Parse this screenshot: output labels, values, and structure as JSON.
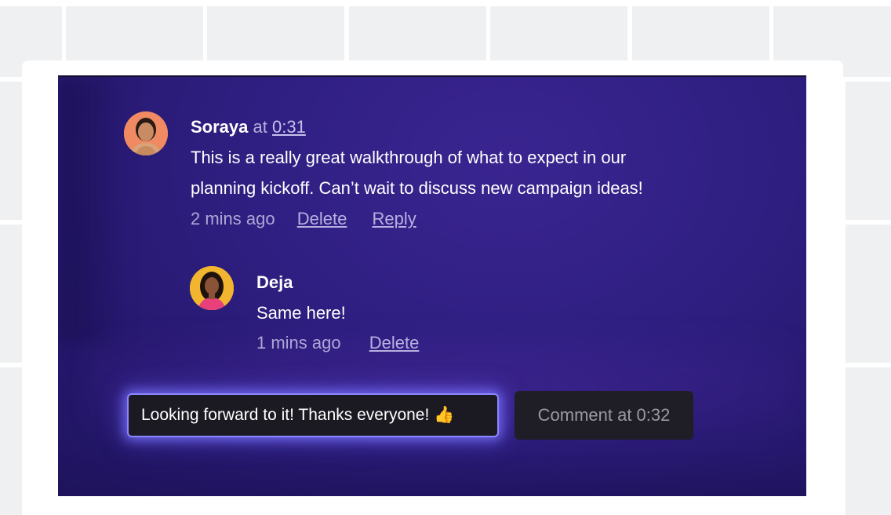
{
  "thread": {
    "comment": {
      "author": "Soraya",
      "at_word": "at",
      "timestamp": "0:31",
      "line1": "This is a really great walkthrough of what to expect in our",
      "line2": "planning kickoff. Can’t wait to discuss new campaign ideas!",
      "age": "2 mins ago",
      "delete_label": "Delete",
      "reply_label": "Reply"
    },
    "reply": {
      "author": "Deja",
      "text": "Same here!",
      "age": "1 mins ago",
      "delete_label": "Delete"
    }
  },
  "composer": {
    "value": "Looking forward to it! Thanks everyone!",
    "emoji": "👍",
    "button_label": "Comment at 0:32"
  },
  "colors": {
    "video_bg": "#2f1f82",
    "input_glow": "#8b87ff",
    "input_bg": "#1b1a23",
    "button_bg": "#1f1e26"
  }
}
